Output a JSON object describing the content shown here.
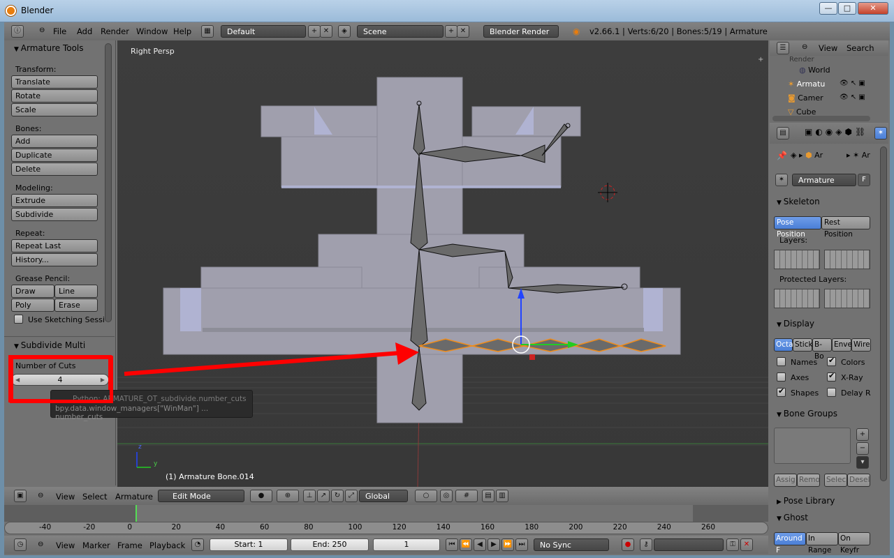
{
  "window": {
    "title": "Blender",
    "min": "—",
    "max": "□",
    "close": "✕"
  },
  "info_header": {
    "menus": [
      "File",
      "Add",
      "Render",
      "Window",
      "Help"
    ],
    "layout": "Default",
    "scene": "Scene",
    "engine": "Blender Render",
    "stats": "v2.66.1 | Verts:6/20 | Bones:5/19 | Armature"
  },
  "tool_shelf": {
    "title": "Armature Tools",
    "transform_label": "Transform:",
    "transform": [
      "Translate",
      "Rotate",
      "Scale"
    ],
    "bones_label": "Bones:",
    "bones": [
      "Add",
      "Duplicate",
      "Delete"
    ],
    "modeling_label": "Modeling:",
    "modeling": [
      "Extrude",
      "Subdivide"
    ],
    "repeat_label": "Repeat:",
    "repeat": [
      "Repeat Last",
      "History..."
    ],
    "grease_label": "Grease Pencil:",
    "draw": "Draw",
    "line": "Line",
    "poly": "Poly",
    "erase": "Erase",
    "sketch": "Use Sketching Sessi",
    "op_title": "Subdivide Multi",
    "cuts_label": "Number of Cuts",
    "cuts_value": "4",
    "tooltip_line1": "Python: ARMATURE_OT_subdivide.number_cuts",
    "tooltip_line2": "bpy.data.window_managers[\"WinMan\"] ... number_cuts"
  },
  "viewport": {
    "view_name": "Right Persp",
    "object_label": "(1) Armature Bone.014",
    "axis_z": "z",
    "axis_y": "y"
  },
  "view_header": {
    "menus": [
      "View",
      "Select",
      "Armature"
    ],
    "mode": "Edit Mode",
    "orientation": "Global"
  },
  "timeline": {
    "ticks": [
      "-40",
      "-20",
      "0",
      "20",
      "40",
      "60",
      "80",
      "100",
      "120",
      "140",
      "160",
      "180",
      "200",
      "220",
      "240",
      "260"
    ],
    "menus": [
      "View",
      "Marker",
      "Frame",
      "Playback"
    ],
    "start": "Start: 1",
    "end": "End: 250",
    "current": "1",
    "sync": "No Sync"
  },
  "outliner": {
    "menus": [
      "View",
      "Search"
    ],
    "items": [
      "Render",
      "World",
      "Armatu",
      "Camer",
      "Cube"
    ]
  },
  "properties": {
    "tabs": [
      "Ar",
      "Ar"
    ],
    "datablock": "Armature",
    "fake": "F",
    "skeleton": "Skeleton",
    "pose_position": "Pose Position",
    "rest_position": "Rest Position",
    "layers": "Layers:",
    "protected_layers": "Protected Layers:",
    "display": "Display",
    "display_types": [
      "Octa",
      "Stick",
      "B-Bo",
      "Enve",
      "Wire"
    ],
    "names": "Names",
    "colors": "Colors",
    "axes": "Axes",
    "xray": "X-Ray",
    "shapes": "Shapes",
    "delay": "Delay R",
    "bone_groups": "Bone Groups",
    "assign": "Assig",
    "remove": "Remo",
    "select": "Selec",
    "deselect": "Desel",
    "pose_library": "Pose Library",
    "ghost": "Ghost",
    "ghost_types": [
      "Around F",
      "In Range",
      "On Keyfr"
    ]
  },
  "colors": {
    "highlight": "#ff0000",
    "selected_bone": "#f08c1a",
    "accent": "#5b8fe6"
  }
}
